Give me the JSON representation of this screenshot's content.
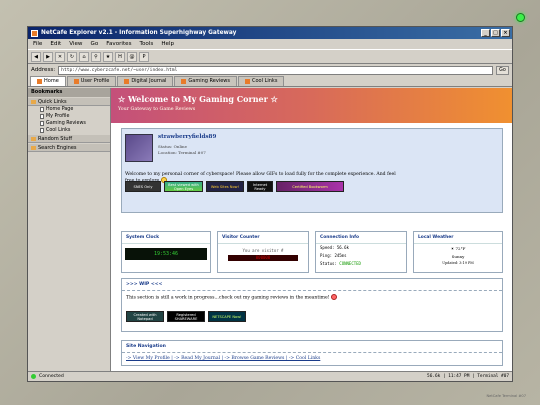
{
  "window": {
    "title": "NetCafe Explorer v2.1 - Information Superhighway Gateway"
  },
  "menu": [
    "File",
    "Edit",
    "View",
    "Go",
    "Favorites",
    "Tools",
    "Help"
  ],
  "address": {
    "label": "Address:",
    "url": "http://www.cyberzcafe.net/~user/index.html",
    "go": "Go"
  },
  "tabs": [
    "Home",
    "User Profile",
    "Digital Journal",
    "Gaming Reviews",
    "Cool Links"
  ],
  "sidebar": {
    "header": "Bookmarks",
    "sections": [
      {
        "label": "Quick Links",
        "items": [
          "Home Page",
          "My Profile",
          "Gaming Reviews",
          "Cool Links"
        ]
      },
      {
        "label": "Random Stuff",
        "items": []
      },
      {
        "label": "Search Engines",
        "items": []
      }
    ]
  },
  "banner": {
    "title": "☆ Welcome to My Gaming Corner ☆",
    "subtitle": "Your Gateway to Game Reviews"
  },
  "profile": {
    "username": "strawberryfields89",
    "status": "Status: Online",
    "location": "Location: Terminal #07",
    "welcome": "Welcome to my personal corner of cyberspace! Please allow GIFs to load fully for the complete experience. And feel free to explore",
    "badges": [
      "SNES Only",
      "Best viewed with Open Eyes",
      "Web Sites Now!",
      "Internet Ready",
      "Certified Bookworm"
    ]
  },
  "widgets": {
    "clock": {
      "title": "System Clock",
      "value": "19:53:46"
    },
    "visitors": {
      "title": "Visitor Counter",
      "text": "You are visitor #",
      "value": "000000"
    },
    "connection": {
      "title": "Connection Info",
      "speed": "Speed: 56.6k",
      "ping": "Ping: 245ms",
      "status_label": "Status:",
      "status": "CONNECTED"
    },
    "weather": {
      "title": "Local Weather",
      "temp": "☀ 72°F",
      "cond": "Sunny",
      "updated": "Updated: 3:19 PM"
    }
  },
  "wip": {
    "title": ">>> WIP <<<",
    "text": "This section is still a work in progress...check out my gaming reviews in the meantime!",
    "badges": [
      "Created with Notepad",
      "Registered SHAREWARE",
      "NETSCAPE Now!"
    ]
  },
  "nav": {
    "title": "Site Navigation",
    "links": "-> View My Profile | -> Read My Journal | -> Browse Game Reviews | -> Cool Links"
  },
  "statusbar": {
    "left": "Connected",
    "right": "56.6k | 11:47 PM | Terminal #07"
  },
  "corner": "NetCafe Terminal #07"
}
